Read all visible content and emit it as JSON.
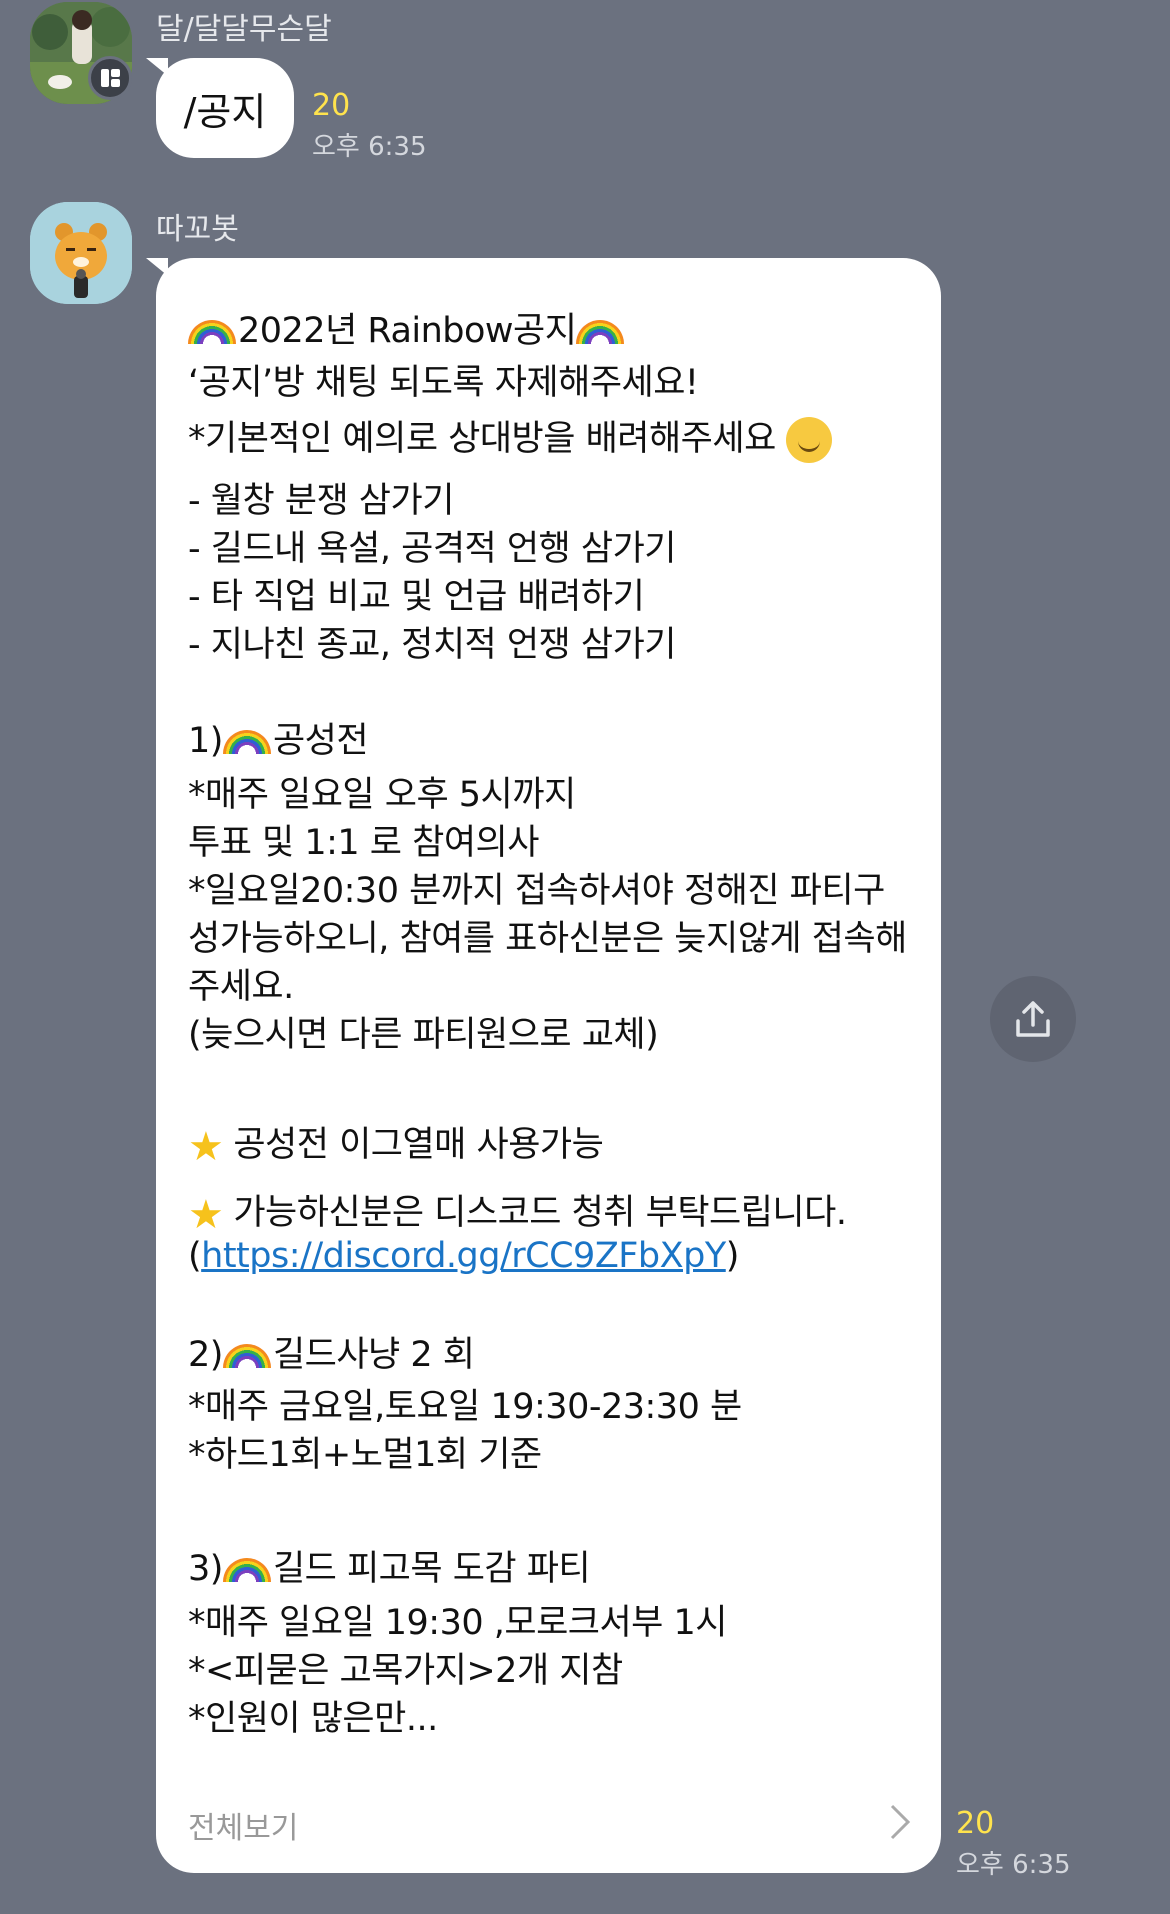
{
  "messages": [
    {
      "sender": "달/달달무슨달",
      "text": "/공지",
      "unread_count": "20",
      "time": "오후 6:35"
    },
    {
      "sender": "따꼬봇",
      "lines": [
        "2022년 Rainbow공지",
        "‘공지’방 채팅 되도록 자제해주세요!",
        "*기본적인 예의로 상대방을 배려해주세요",
        "- 월창 분쟁 삼가기",
        "- 길드내 욕설, 공격적 언행 삼가기",
        "- 타 직업 비교 및 언급 배려하기",
        "- 지나친 종교, 정치적 언쟁 삼가기",
        "1)",
        "공성전",
        "*매주 일요일 오후 5시까지",
        "투표 및 1:1 로 참여의사",
        "*일요일20:30 분까지 접속하셔야 정해진 파티구",
        "성가능하오니, 참여를 표하신분은 늦지않게 접속해",
        "주세요.",
        "(늦으시면 다른 파티원으로 교체)",
        "공성전 이그열매 사용가능",
        "가능하신분은 디스코드 청취 부탁드립니다.",
        "(",
        "https://discord.gg/rCC9ZFbXpY",
        ")",
        "2)",
        "길드사냥 2 회",
        "*매주 금요일,토요일 19:30-23:30 분",
        "*하드1회+노멀1회 기준",
        "3)",
        "길드 피고목 도감 파티",
        "*매주 일요일 19:30 ,모로크서부 1시",
        "*<피묻은 고목가지>2개 지참",
        "*인원이 많은만..."
      ],
      "see_all": "전체보기",
      "unread_count": "20",
      "time": "오후 6:35"
    }
  ],
  "icons": {
    "share": "share-icon",
    "chevron": "chevron-right-icon",
    "rainbow": "rainbow-emoji",
    "star": "star-emoji",
    "smile": "smiling-face-emoji"
  },
  "colors": {
    "background": "#6b717f",
    "bubble": "#ffffff",
    "unread": "#ffe34d",
    "link": "#1a74c6"
  }
}
